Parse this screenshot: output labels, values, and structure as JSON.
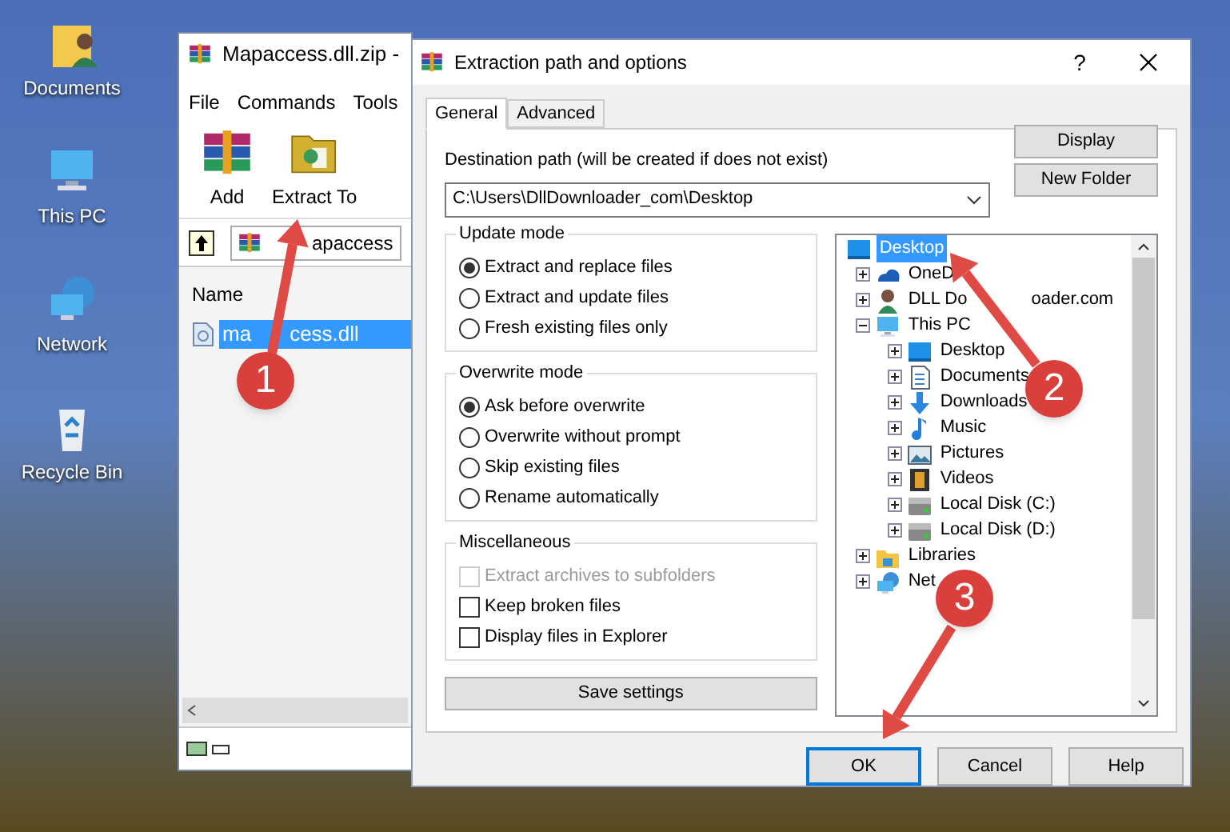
{
  "desktop_icons": [
    {
      "label": "Documents",
      "kind": "documents"
    },
    {
      "label": "This PC",
      "kind": "computer"
    },
    {
      "label": "Network",
      "kind": "network"
    },
    {
      "label": "Recycle Bin",
      "kind": "recycle"
    }
  ],
  "archive_window": {
    "title": "Mapaccess.dll.zip -",
    "menu": [
      "File",
      "Commands",
      "Tools"
    ],
    "toolbar": [
      {
        "label": "Add",
        "kind": "add"
      },
      {
        "label": "Extract To",
        "kind": "extract"
      }
    ],
    "address": "apaccess",
    "column": "Name",
    "files": [
      {
        "parts": [
          "ma",
          "cess.dll"
        ],
        "selected": true
      }
    ]
  },
  "dialog": {
    "title": "Extraction path and options",
    "help_mark": "?",
    "tabs": [
      {
        "label": "General",
        "selected": true
      },
      {
        "label": "Advanced",
        "selected": false
      }
    ],
    "destination_label": "Destination path (will be created if does not exist)",
    "destination_path": "C:\\Users\\DllDownloader_com\\Desktop",
    "side_buttons": [
      "Display",
      "New Folder"
    ],
    "groups": [
      {
        "title": "Update mode",
        "items": [
          {
            "label": "Extract and replace files",
            "kind": "radio",
            "selected": true,
            "disabled": false
          },
          {
            "label": "Extract and update files",
            "kind": "radio",
            "selected": false,
            "disabled": false
          },
          {
            "label": "Fresh existing files only",
            "kind": "radio",
            "selected": false,
            "disabled": false
          }
        ]
      },
      {
        "title": "Overwrite mode",
        "items": [
          {
            "label": "Ask before overwrite",
            "kind": "radio",
            "selected": true,
            "disabled": false
          },
          {
            "label": "Overwrite without prompt",
            "kind": "radio",
            "selected": false,
            "disabled": false
          },
          {
            "label": "Skip existing files",
            "kind": "radio",
            "selected": false,
            "disabled": false
          },
          {
            "label": "Rename automatically",
            "kind": "radio",
            "selected": false,
            "disabled": false
          }
        ]
      },
      {
        "title": "Miscellaneous",
        "items": [
          {
            "label": "Extract archives to subfolders",
            "kind": "checkbox",
            "checked": false,
            "disabled": true
          },
          {
            "label": "Keep broken files",
            "kind": "checkbox",
            "checked": false,
            "disabled": false
          },
          {
            "label": "Display files in Explorer",
            "kind": "checkbox",
            "checked": false,
            "disabled": false
          }
        ]
      }
    ],
    "save_button": "Save settings",
    "tree": [
      {
        "parts": [
          "Desktop"
        ],
        "kind": "monitor",
        "selected": true,
        "children": [
          {
            "parts": [
              "OneD"
            ],
            "kind": "cloud",
            "selected": false,
            "expanded": false
          },
          {
            "parts": [
              "DLL Do",
              "oader.com"
            ],
            "kind": "person",
            "selected": false,
            "expanded": false
          },
          {
            "parts": [
              "This PC"
            ],
            "kind": "computer",
            "selected": false,
            "expanded": true,
            "children": [
              {
                "parts": [
                  "Desktop"
                ],
                "kind": "monitor",
                "selected": false,
                "expanded": false
              },
              {
                "parts": [
                  "Documents"
                ],
                "kind": "document",
                "selected": false,
                "expanded": false
              },
              {
                "parts": [
                  "Downloads"
                ],
                "kind": "download",
                "selected": false,
                "expanded": false
              },
              {
                "parts": [
                  "Music"
                ],
                "kind": "music",
                "selected": false,
                "expanded": false
              },
              {
                "parts": [
                  "Pictures"
                ],
                "kind": "picture",
                "selected": false,
                "expanded": false
              },
              {
                "parts": [
                  "Videos"
                ],
                "kind": "film",
                "selected": false,
                "expanded": false
              },
              {
                "parts": [
                  "Local Disk (C:)"
                ],
                "kind": "drive",
                "selected": false,
                "expanded": false
              },
              {
                "parts": [
                  "Local Disk (D:)"
                ],
                "kind": "drive",
                "selected": false,
                "expanded": false
              }
            ]
          },
          {
            "parts": [
              "Libraries"
            ],
            "kind": "folder",
            "selected": false,
            "expanded": false
          },
          {
            "parts": [
              "Net"
            ],
            "kind": "network",
            "selected": false,
            "expanded": false
          }
        ]
      }
    ],
    "buttons": [
      {
        "label": "OK",
        "default": true
      },
      {
        "label": "Cancel",
        "default": false
      },
      {
        "label": "Help",
        "default": false
      }
    ]
  },
  "annotations": [
    "1",
    "2",
    "3"
  ]
}
